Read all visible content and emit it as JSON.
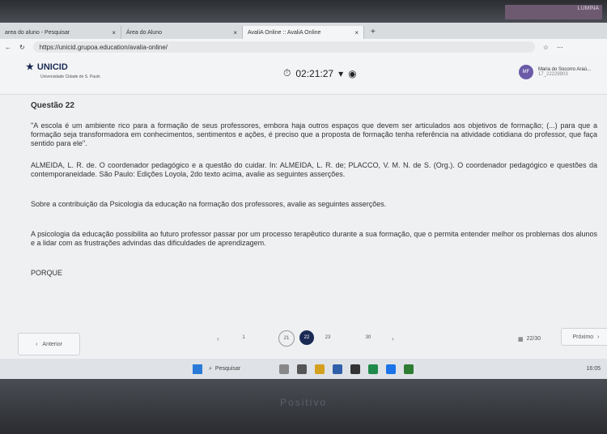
{
  "sticker": "LUMINA",
  "browser": {
    "tabs": [
      {
        "label": "area do aluno - Pesquisar"
      },
      {
        "label": "Área do Aluno"
      },
      {
        "label": "AvaliA Online :: AvaliA Online"
      }
    ],
    "url": "https://unicid.grupoa.education/avalia-online/"
  },
  "header": {
    "logo": "UNICID",
    "logo_sub": "Universidade Cidade de S. Paulo",
    "timer": "02:21:27",
    "user_initials": "MF",
    "user_name": "Maria do Socorro Araú...",
    "user_id": "17_22229903"
  },
  "question": {
    "title": "Questão 22",
    "quote": "\"A escola é um ambiente rico para a formação de seus professores, embora haja outros espaços que devem ser articulados aos objetivos de formação; (...) para que a formação seja transformadora em conhecimentos, sentimentos e ações, é preciso que a proposta de formação tenha referência na atividade cotidiana do professor, que faça sentido para ele\".",
    "reference": "ALMEIDA, L. R. de. O coordenador pedagógico e a questão do cuidar. In: ALMEIDA, L. R. de; PLACCO, V. M. N. de S. (Org.). O coordenador pedagógico e questões da contemporaneidade. São Paulo: Edições Loyola, 2do texto acima, avalie as seguintes asserções.",
    "prompt": "Sobre a contribuição da Psicologia da educação na formação dos professores, avalie as seguintes asserções.",
    "assertion_1": "A psicologia da educação possibilita ao futuro professor passar por um processo terapêutico durante a sua formação, que o permita entender melhor os problemas dos alunos e a lidar com as frustrações advindas das dificuldades de aprendizagem.",
    "connector": "PORQUE"
  },
  "pager": {
    "prev_label": "Anterior",
    "next_label": "Próximo",
    "pages": [
      "1",
      "21",
      "22",
      "23",
      "30"
    ],
    "progress": "22/30"
  },
  "taskbar": {
    "search_placeholder": "Pesquisar",
    "time": "16:05"
  },
  "bezel_brand": "Positivo"
}
